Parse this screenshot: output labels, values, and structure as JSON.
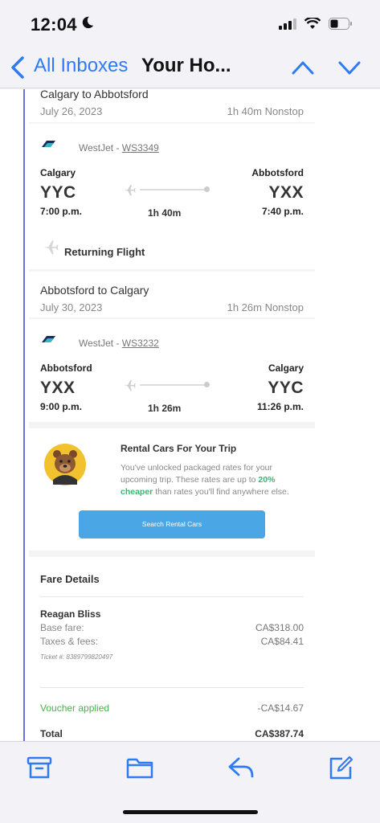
{
  "status": {
    "time": "12:04"
  },
  "nav": {
    "back_label": "All Inboxes",
    "title": "Your Ho..."
  },
  "outbound": {
    "route": "Calgary to Abbotsford",
    "date": "July 26, 2023",
    "duration_stops": "1h 40m  Nonstop",
    "airline": "WestJet - ",
    "flight": "WS3349",
    "from_city": "Calgary",
    "from_code": "YYC",
    "depart_time": "7:00 p.m.",
    "to_city": "Abbotsford",
    "to_code": "YXX",
    "arrive_time": "7:40 p.m.",
    "duration": "1h 40m"
  },
  "returning_label": "Returning Flight",
  "return": {
    "route": "Abbotsford to Calgary",
    "date": "July 30, 2023",
    "duration_stops": "1h 26m  Nonstop",
    "airline": "WestJet - ",
    "flight": "WS3232",
    "from_city": "Abbotsford",
    "from_code": "YXX",
    "depart_time": "9:00 p.m.",
    "to_city": "Calgary",
    "to_code": "YYC",
    "arrive_time": "11:26 p.m.",
    "duration": "1h 26m"
  },
  "rental": {
    "title": "Rental Cars For Your Trip",
    "body_pre": "You've unlocked packaged rates for your upcoming trip. These rates are up to ",
    "body_highlight": "20% cheaper",
    "body_post": " than rates you'll find anywhere else.",
    "button": "Search Rental Cars"
  },
  "fare": {
    "title": "Fare Details",
    "passenger": "Reagan Bliss",
    "base_label": "Base fare:",
    "base_value": "CA$318.00",
    "taxes_label": "Taxes & fees:",
    "taxes_value": "CA$84.41",
    "ticket": "Ticket #: 8389799820497",
    "voucher_label": "Voucher applied",
    "voucher_value": "-CA$14.67",
    "total_label": "Total",
    "total_value": "CA$387.74"
  },
  "colors": {
    "accent": "#2f7bf6",
    "button": "#4aa6e5",
    "voucher": "#4caf50",
    "highlight": "#3cb371"
  },
  "icons": [
    "moon-icon",
    "signal-icon",
    "wifi-icon",
    "battery-icon",
    "back-chevron-icon",
    "up-chevron-icon",
    "down-chevron-icon",
    "westjet-logo-icon",
    "plane-icon",
    "mascot-avatar",
    "archive-icon",
    "folder-icon",
    "reply-icon",
    "compose-icon"
  ]
}
